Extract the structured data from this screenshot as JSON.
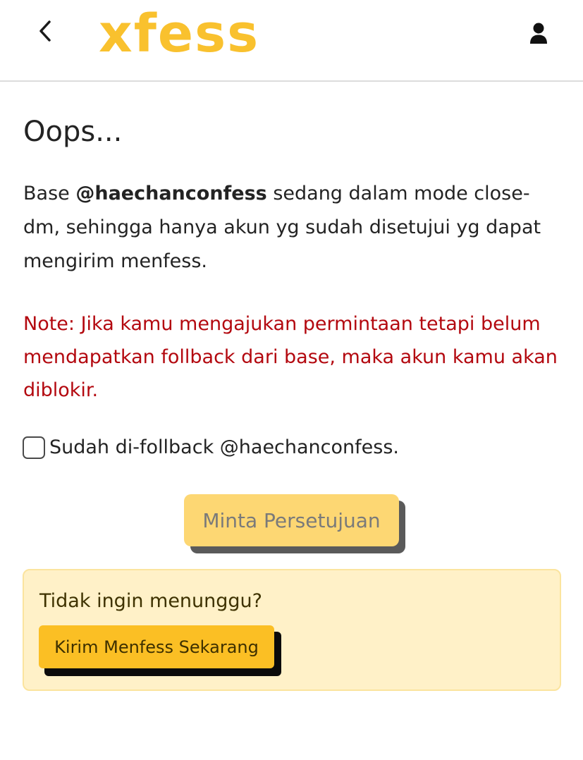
{
  "header": {
    "logo_text": "xfess",
    "back_icon": "chevron-left-icon",
    "profile_icon": "user-icon",
    "brand_color": "#f9c12e"
  },
  "main": {
    "title": "Oops...",
    "intro": {
      "prefix": "Base ",
      "handle": "@haechanconfess",
      "suffix": " sedang dalam mode close-dm, sehingga hanya akun yg sudah disetujui yg dapat mengirim menfess."
    },
    "note": "Note: Jika kamu mengajukan permintaan tetapi belum mendapatkan follback dari base, maka akun kamu akan diblokir.",
    "note_color": "#b3080f",
    "checkbox": {
      "label": "Sudah di-follback @haechanconfess.",
      "checked": false
    },
    "request_button": {
      "label": "Minta Persetujuan",
      "disabled": true
    }
  },
  "promo": {
    "title": "Tidak ingin menunggu?",
    "button_label": "Kirim Menfess Sekarang",
    "background": "#fff1c8",
    "button_color": "#fbbf24"
  }
}
